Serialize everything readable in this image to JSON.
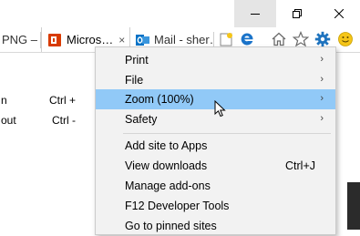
{
  "tabs": [
    {
      "label": "PNG –",
      "icon": "image-icon"
    },
    {
      "label": "Micros…",
      "icon": "office-icon"
    },
    {
      "label": "Mail - sher…",
      "icon": "outlook-icon"
    }
  ],
  "tab_close_glyph": "×",
  "toolbar_icons": [
    "new-tab-icon",
    "edge-icon",
    "home-icon",
    "favorites-star-icon",
    "gear-icon",
    "smiley-icon"
  ],
  "behind_menu": [
    {
      "text": "n",
      "shortcut": "Ctrl +"
    },
    {
      "text": "out",
      "shortcut": "Ctrl -"
    }
  ],
  "menu": {
    "items": [
      {
        "label": "Print",
        "shortcut": "",
        "arrow": "›"
      },
      {
        "label": "File",
        "shortcut": "",
        "arrow": "›"
      },
      {
        "label": "Zoom (100%)",
        "shortcut": "",
        "arrow": "›"
      },
      {
        "label": "Safety",
        "shortcut": "",
        "arrow": "›"
      },
      {
        "label": "Add site to Apps",
        "shortcut": "",
        "arrow": ""
      },
      {
        "label": "View downloads",
        "shortcut": "Ctrl+J",
        "arrow": ""
      },
      {
        "label": "Manage add-ons",
        "shortcut": "",
        "arrow": ""
      },
      {
        "label": "F12 Developer Tools",
        "shortcut": "",
        "arrow": ""
      },
      {
        "label": "Go to pinned sites",
        "shortcut": "",
        "arrow": ""
      }
    ],
    "highlighted_item": "Zoom (100%)"
  },
  "colors": {
    "highlight": "#91c9f7",
    "menu_bg": "#f2f2f2",
    "gear_blue": "#1e73be",
    "office_orange": "#d83b01",
    "outlook_blue": "#0072c6"
  }
}
